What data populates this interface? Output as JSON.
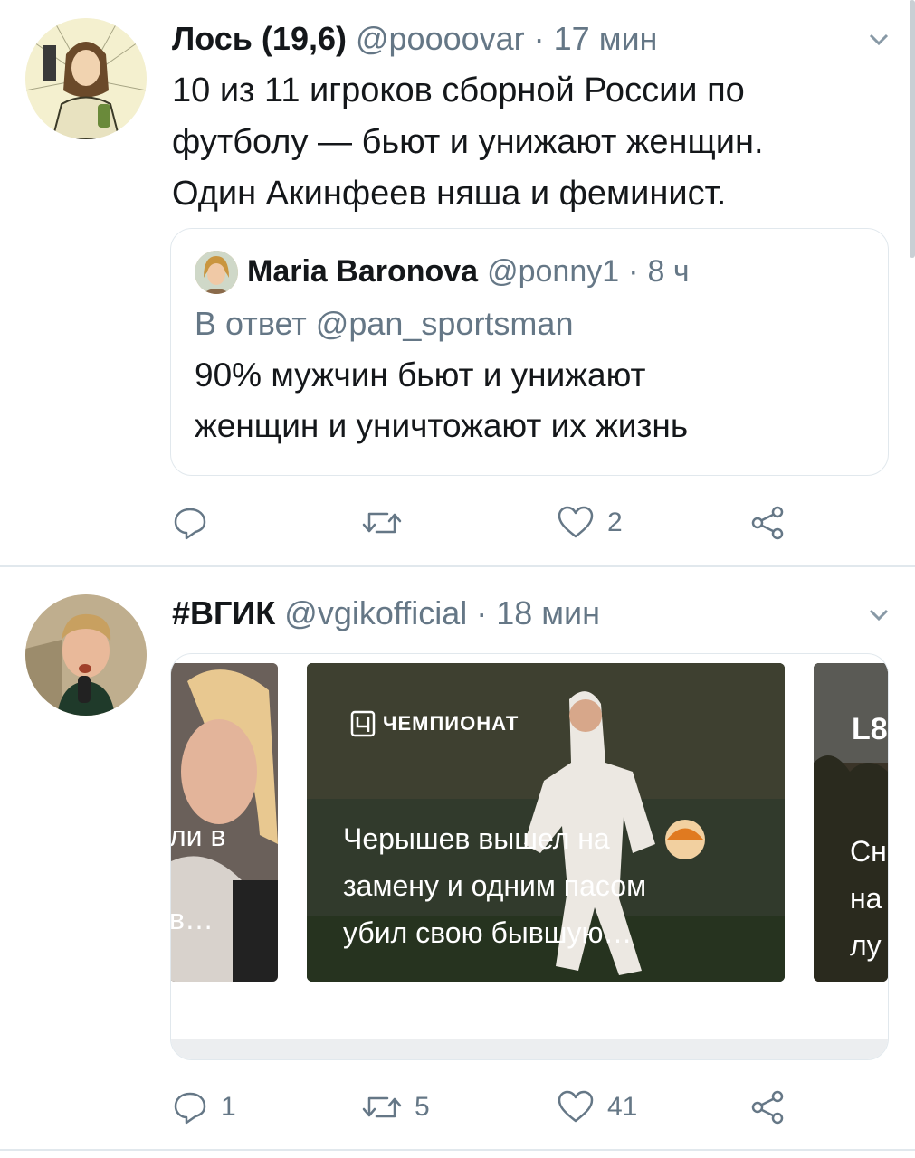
{
  "tweet1": {
    "author_name": "Лось (19,6)",
    "handle": "@poooovar",
    "separator": "·",
    "time": "17 мин",
    "text_lines": [
      "10 из 11 игроков сборной России по",
      "футболу — бьют и унижают женщин.",
      "Один Акинфеев няша и феминист."
    ],
    "quote": {
      "author_name": "Maria Baronova",
      "handle": "@ponny1",
      "separator": "·",
      "time": "8 ч",
      "reply_to": "В ответ @pan_sportsman",
      "text_lines": [
        "90% мужчин бьют и унижают",
        "женщин и уничтожают их жизнь"
      ]
    },
    "actions": {
      "reply_count": "",
      "retweet_count": "",
      "like_count": "2"
    }
  },
  "tweet2": {
    "author_name": "#ВГИК",
    "handle": "@vgikofficial",
    "separator": "·",
    "time": "18 мин",
    "slides": [
      {
        "text_lines": [
          "ли в",
          "в…"
        ]
      },
      {
        "brand": "ЧЕМПИОНАТ",
        "text_lines": [
          "Черышев вышел на",
          "замену и одним пасом",
          "убил свою бывшую…"
        ]
      },
      {
        "brand": "L8",
        "text_lines": [
          "Сн",
          "на",
          "лу"
        ]
      }
    ],
    "actions": {
      "reply_count": "1",
      "retweet_count": "5",
      "like_count": "41"
    }
  },
  "icons": {
    "reply": "reply-icon",
    "retweet": "retweet-icon",
    "like": "heart-icon",
    "share": "share-icon",
    "chevron": "chevron-down-icon"
  },
  "colors": {
    "text": "#14171a",
    "secondary": "#657786",
    "border": "#e1e8ed"
  }
}
